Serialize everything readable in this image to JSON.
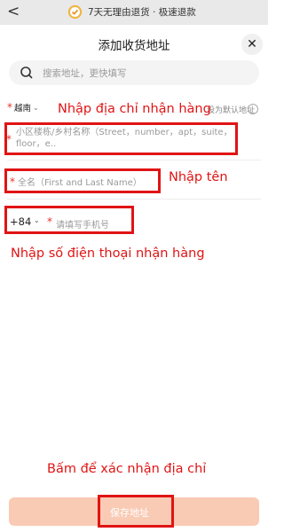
{
  "banner": {
    "text": "7天无理由退货 · 极速退款"
  },
  "header": {
    "title": "添加收货地址"
  },
  "search": {
    "placeholder": "搜索地址，更快填写"
  },
  "country": {
    "name": "越南",
    "default_label": "设为默认地址"
  },
  "form": {
    "address_placeholder": "小区楼栋/乡村名称（Street，number，apt，suite，floor，e..",
    "name_placeholder": "全名（First and Last Name）",
    "phone_code": "+84",
    "phone_placeholder": "请填写手机号"
  },
  "annotations": {
    "address": "Nhập địa chỉ nhận hàng",
    "name": "Nhập tên",
    "phone": "Nhập số điện thoại nhận hàng",
    "confirm": "Bấm để xác nhận địa chỉ"
  },
  "footer": {
    "save_label": "保存地址"
  },
  "colors": {
    "annotation": "#e01414",
    "required": "#e4342b",
    "save_bg": "#f9cab4"
  }
}
